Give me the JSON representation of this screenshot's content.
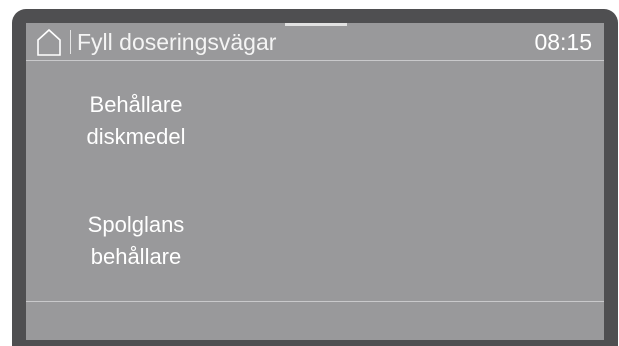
{
  "header": {
    "home_icon": "home-icon",
    "title": "Fyll doseringsvägar",
    "time": "08:15"
  },
  "menu": {
    "items": [
      {
        "line1": "Behållare",
        "line2": "diskmedel"
      },
      {
        "line1": "Spolglans",
        "line2": "behållare"
      }
    ]
  },
  "colors": {
    "bezel": "#4f4f51",
    "screen": "#99999b",
    "text": "#ffffff"
  }
}
